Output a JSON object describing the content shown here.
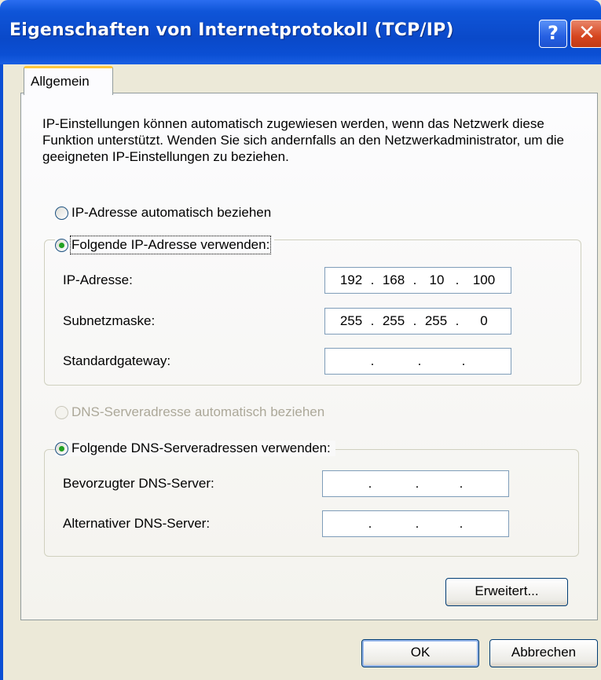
{
  "window": {
    "title": "Eigenschaften von Internetprotokoll (TCP/IP)",
    "help_label": "?",
    "close_label": "✕"
  },
  "tabs": [
    {
      "label": "Allgemein",
      "selected": true
    }
  ],
  "intro": "IP-Einstellungen können automatisch zugewiesen werden, wenn das Netzwerk diese Funktion unterstützt. Wenden Sie sich andernfalls an den Netzwerkadministrator, um die geeigneten IP-Einstellungen zu beziehen.",
  "ip_mode": {
    "auto_label": "IP-Adresse automatisch beziehen",
    "manual_label": "Folgende IP-Adresse verwenden:",
    "selected": "manual"
  },
  "ip_fields": [
    {
      "label": "IP-Adresse:",
      "octets": [
        "192",
        "168",
        "10",
        "100"
      ]
    },
    {
      "label": "Subnetzmaske:",
      "octets": [
        "255",
        "255",
        "255",
        "0"
      ]
    },
    {
      "label": "Standardgateway:",
      "octets": [
        "",
        "",
        "",
        ""
      ]
    }
  ],
  "dns_mode": {
    "auto_label": "DNS-Serveradresse automatisch beziehen",
    "manual_label": "Folgende DNS-Serveradressen verwenden:",
    "selected": "manual",
    "auto_disabled": true
  },
  "dns_fields": [
    {
      "label": "Bevorzugter DNS-Server:",
      "octets": [
        "",
        "",
        "",
        ""
      ]
    },
    {
      "label": "Alternativer DNS-Server:",
      "octets": [
        "",
        "",
        "",
        ""
      ]
    }
  ],
  "buttons": {
    "advanced": "Erweitert...",
    "ok": "OK",
    "cancel": "Abbrechen"
  },
  "colors": {
    "titlebar": "#0a49c9",
    "dialog_bg": "#ece9d8",
    "tab_highlight": "#ffc83c",
    "radio_dot": "#21a121"
  }
}
